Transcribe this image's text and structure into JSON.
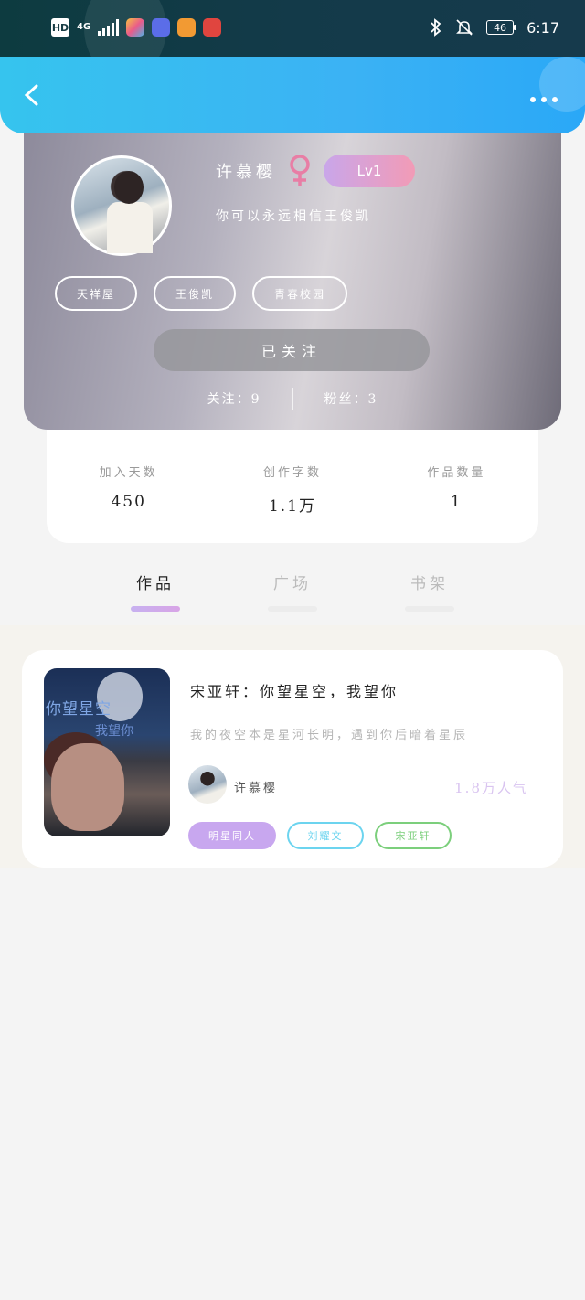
{
  "status_bar": {
    "hd": "HD",
    "network": "4G",
    "battery": "46",
    "time": "6:17"
  },
  "header": {
    "back_icon": "chevron-left-icon",
    "more_icon": "more-dots-icon"
  },
  "profile": {
    "name": "许慕樱",
    "gender_icon": "female-icon",
    "level": "Lv1",
    "motto": "你可以永远相信王俊凯",
    "tags": [
      "天祥屋",
      "王俊凯",
      "青春校园"
    ],
    "follow_button": "已关注",
    "following_label": "关注：",
    "following_count": "9",
    "fans_label": "粉丝：",
    "fans_count": "3"
  },
  "counts": [
    {
      "label": "加入天数",
      "value": "450"
    },
    {
      "label": "创作字数",
      "value": "1.1万"
    },
    {
      "label": "作品数量",
      "value": "1"
    }
  ],
  "tabs": [
    {
      "label": "作品",
      "active": true
    },
    {
      "label": "广场",
      "active": false
    },
    {
      "label": "书架",
      "active": false
    }
  ],
  "post": {
    "title": "宋亚轩：你望星空，我望你",
    "subtitle": "我的夜空本是星河长明，遇到你后暗着星辰",
    "thumb_text_1": "你望星空",
    "thumb_text_2": "我望你",
    "author": "许慕樱",
    "views": "1.8万人气",
    "tags": [
      "明星同人",
      "刘耀文",
      "宋亚轩"
    ]
  },
  "colors": {
    "header_accent": "#36c4ee",
    "lv_gradient_start": "#c9a6ea",
    "lv_gradient_end": "#f29bb6",
    "tab_underline": "#c7b1f0",
    "tag_purple": "#c8a7ef",
    "tag_blue": "#6cd4ef",
    "tag_green": "#7ccf7c"
  }
}
